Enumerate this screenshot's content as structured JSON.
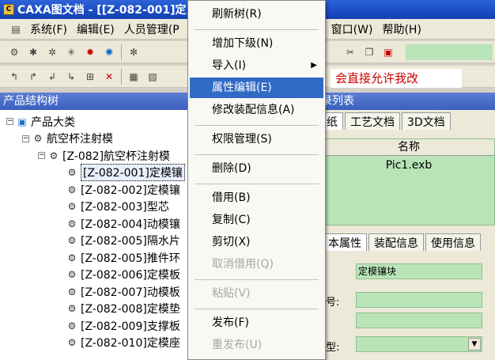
{
  "window": {
    "title": "CAXA图文档 - [[Z-082-001]定",
    "icon": "CAXA"
  },
  "menubar": [
    "系统(F)",
    "编辑(E)",
    "人员管理(P",
    "窗口(W)",
    "帮助(H)"
  ],
  "hint_text": "会直接允许我改",
  "left_panel": {
    "title": "产品结构树"
  },
  "tree": [
    {
      "label": "产品大类",
      "level": 0,
      "exp": "−",
      "icon": "cube-icon"
    },
    {
      "label": "航空杯注射模",
      "level": 1,
      "exp": "−",
      "icon": "assembly-icon"
    },
    {
      "label": "[Z-082]航空杯注射模",
      "level": 2,
      "exp": "−",
      "icon": "assembly-icon"
    },
    {
      "label": "[Z-082-001]定模镶",
      "level": 3,
      "icon": "part-icon",
      "selected": true
    },
    {
      "label": "[Z-082-002]定模镶",
      "level": 3,
      "icon": "part-icon"
    },
    {
      "label": "[Z-082-003]型芯",
      "level": 3,
      "icon": "part-icon"
    },
    {
      "label": "[Z-082-004]动模镶",
      "level": 3,
      "icon": "part-icon"
    },
    {
      "label": "[Z-082-005]隔水片",
      "level": 3,
      "icon": "part-icon"
    },
    {
      "label": "[Z-082-005]推件环",
      "level": 3,
      "icon": "part-icon"
    },
    {
      "label": "[Z-082-006]定模板",
      "level": 3,
      "icon": "part-icon"
    },
    {
      "label": "[Z-082-007]动模板",
      "level": 3,
      "icon": "part-icon"
    },
    {
      "label": "[Z-082-008]定模垫",
      "level": 3,
      "icon": "part-icon"
    },
    {
      "label": "[Z-082-009]支撑板",
      "level": 3,
      "icon": "part-icon"
    },
    {
      "label": "[Z-082-010]定模座",
      "level": 3,
      "icon": "part-icon"
    }
  ],
  "right_panel": {
    "title": "录列表",
    "tabs": [
      "纸",
      "工艺文档",
      "3D文档"
    ],
    "grid_header": "名称",
    "grid_rows": [
      "Pic1.exb"
    ],
    "tabs2": [
      "本属性",
      "装配信息",
      "使用信息"
    ],
    "field1_value": "定模镶块",
    "label_code": "号:",
    "label_type": "型:"
  },
  "context_menu": [
    {
      "label": "刷新树(R)",
      "state": "normal"
    },
    {
      "sep": true
    },
    {
      "label": "增加下级(N)",
      "state": "normal"
    },
    {
      "label": "导入(I)",
      "state": "normal",
      "submenu": true
    },
    {
      "label": "属性编辑(E)",
      "state": "highlight"
    },
    {
      "label": "修改装配信息(A)",
      "state": "normal"
    },
    {
      "sep": true
    },
    {
      "label": "权限管理(S)",
      "state": "normal"
    },
    {
      "sep": true
    },
    {
      "label": "删除(D)",
      "state": "normal"
    },
    {
      "sep": true
    },
    {
      "label": "借用(B)",
      "state": "normal"
    },
    {
      "label": "复制(C)",
      "state": "normal"
    },
    {
      "label": "剪切(X)",
      "state": "normal"
    },
    {
      "label": "取消借用(Q)",
      "state": "disabled"
    },
    {
      "sep": true
    },
    {
      "label": "粘贴(V)",
      "state": "disabled"
    },
    {
      "sep": true
    },
    {
      "label": "发布(F)",
      "state": "normal"
    },
    {
      "label": "重发布(U)",
      "state": "disabled"
    }
  ]
}
